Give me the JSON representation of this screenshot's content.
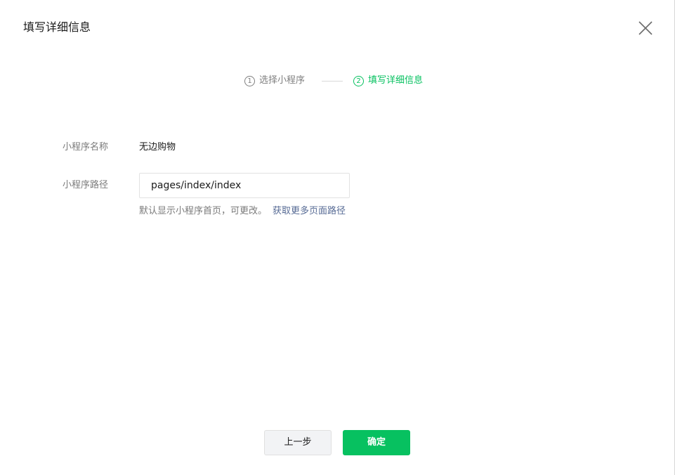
{
  "dialog": {
    "title": "填写详细信息"
  },
  "steps": [
    {
      "number": "1",
      "label": "选择小程序",
      "state": "done"
    },
    {
      "number": "2",
      "label": "填写详细信息",
      "state": "active"
    }
  ],
  "form": {
    "name_label": "小程序名称",
    "name_value": "无边购物",
    "path_label": "小程序路径",
    "path_value": "pages/index/index",
    "hint_text": "默认显示小程序首页，可更改。",
    "hint_link": "获取更多页面路径"
  },
  "buttons": {
    "prev_label": "上一步",
    "ok_label": "确定"
  },
  "colors": {
    "accent": "#07c160",
    "link": "#576b95",
    "muted_text": "#7a7a7a"
  },
  "icons": {
    "close": "close-icon"
  }
}
